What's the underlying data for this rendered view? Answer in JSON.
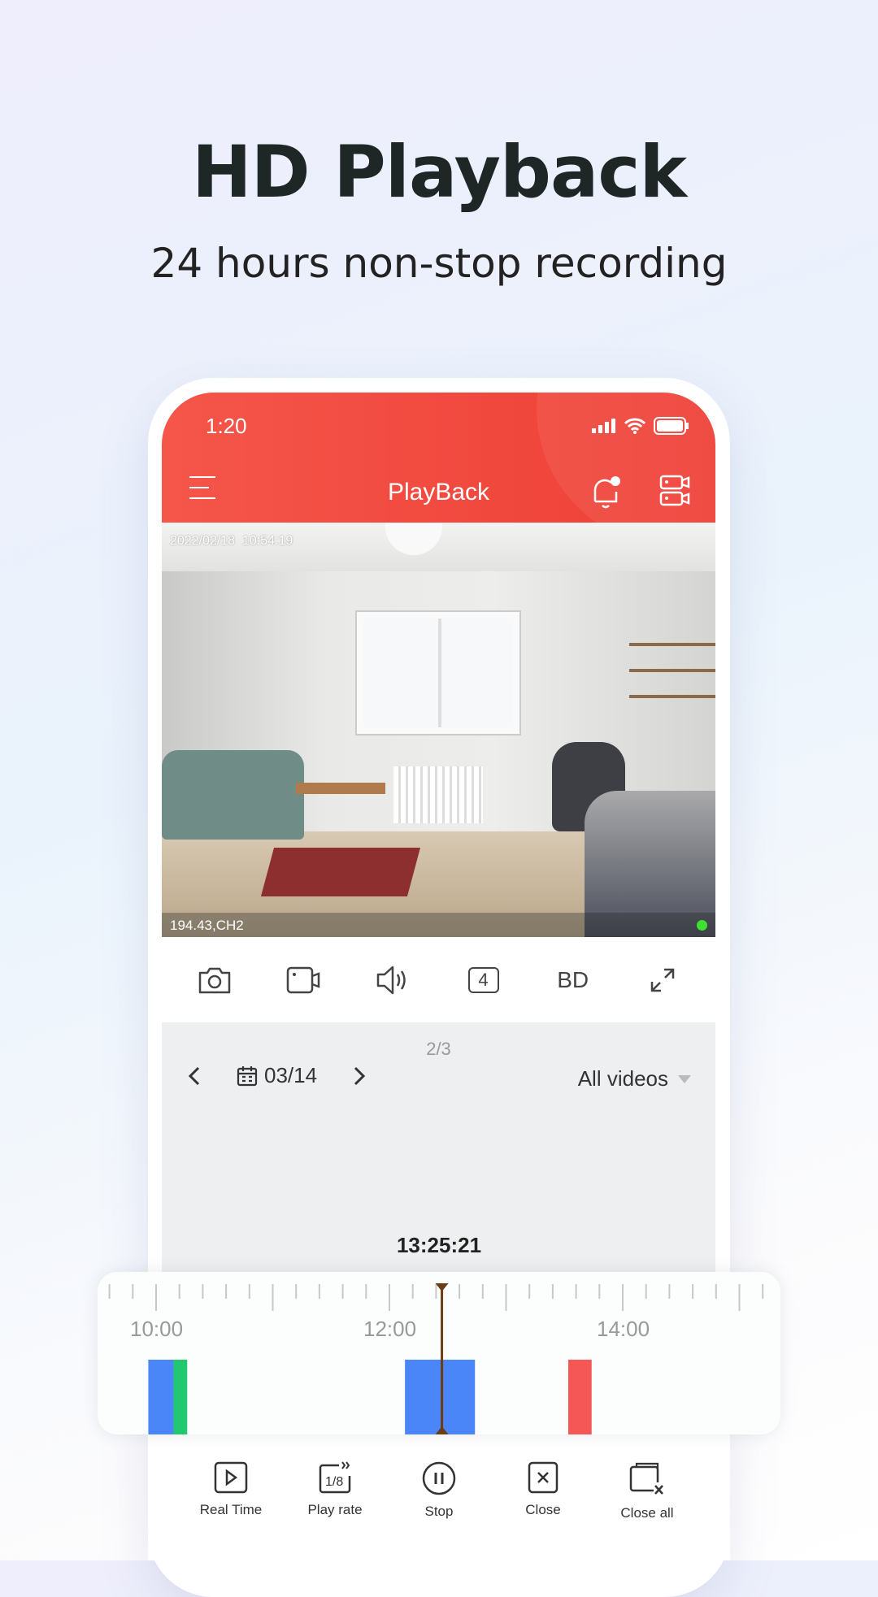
{
  "hero": {
    "title": "HD Playback",
    "subtitle": "24 hours non-stop recording"
  },
  "status_bar": {
    "time": "1:20"
  },
  "header": {
    "title": "PlayBack",
    "icons": [
      "menu-icon",
      "bell-icon",
      "cameras-icon"
    ],
    "color": "#f04a3f"
  },
  "video": {
    "timestamp": "2022/02/18  10:54:19",
    "channel": "194.43,CH2",
    "status_color": "#3fe030"
  },
  "controls": {
    "icons": [
      "camera-icon",
      "record-icon",
      "speaker-icon",
      "split-4-icon"
    ],
    "split_label": "4",
    "quality_label": "BD"
  },
  "playback": {
    "pager": "2/3",
    "date": "03/14",
    "filter": "All videos",
    "current_time": "13:25:21"
  },
  "chart_data": {
    "type": "timeline",
    "tick_labels": [
      "10:00",
      "12:00",
      "14:00"
    ],
    "range": [
      "09:40",
      "15:15"
    ],
    "cursor": "12:27",
    "segments": [
      {
        "start": "09:56",
        "end": "10:09",
        "color": "#4a86f7"
      },
      {
        "start": "10:09",
        "end": "10:16",
        "color": "#22c870"
      },
      {
        "start": "12:08",
        "end": "12:44",
        "color": "#4a86f7"
      },
      {
        "start": "13:32",
        "end": "13:44",
        "color": "#f55656"
      }
    ]
  },
  "toolbar": [
    {
      "label": "Real Time",
      "icon": "play-box-icon"
    },
    {
      "label": "Play rate",
      "icon": "play-rate-icon"
    },
    {
      "label": "Stop",
      "icon": "pause-icon"
    },
    {
      "label": "Close",
      "icon": "close-box-icon"
    },
    {
      "label": "Close all",
      "icon": "close-all-icon"
    }
  ]
}
